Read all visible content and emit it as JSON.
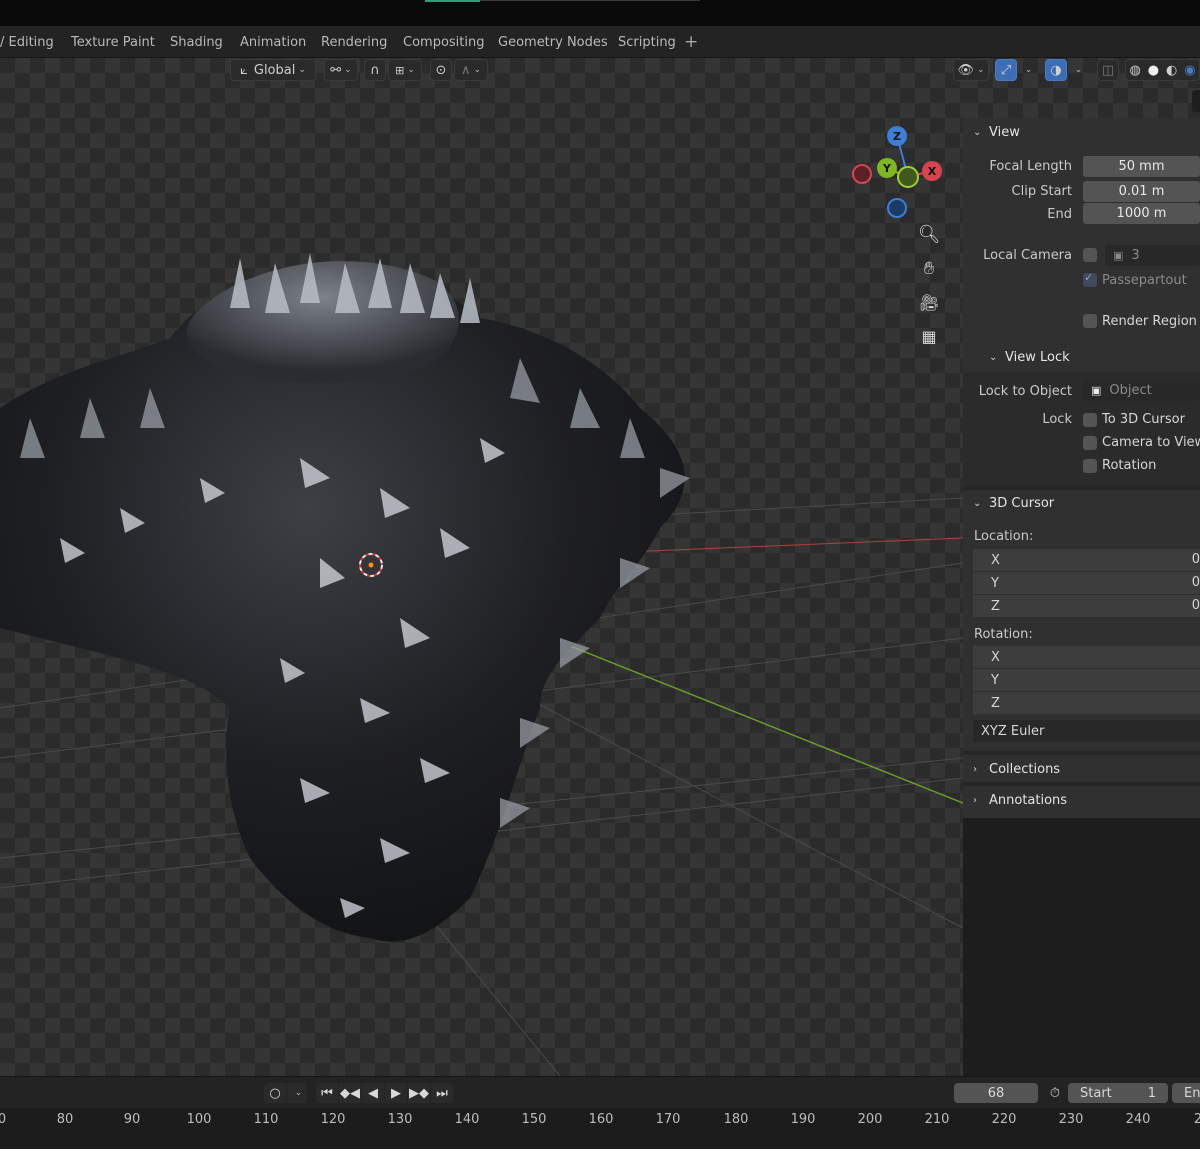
{
  "workspace_tabs": [
    "/ Editing",
    "Texture Paint",
    "Shading",
    "Animation",
    "Rendering",
    "Compositing",
    "Geometry Nodes",
    "Scripting"
  ],
  "add_tab_label": "+",
  "viewport_header": {
    "orientation_label": "Global"
  },
  "gizmo": {
    "x_label": "X",
    "y_label": "Y",
    "z_label": "Z"
  },
  "sidebar": {
    "view": {
      "title": "View",
      "focal_length_label": "Focal Length",
      "focal_length_value": "50 mm",
      "clip_start_label": "Clip Start",
      "clip_start_value": "0.01 m",
      "clip_end_label": "End",
      "clip_end_value": "1000 m",
      "local_camera_label": "Local Camera",
      "local_camera_value": "3",
      "passepartout_label": "Passepartout",
      "render_region_label": "Render Region"
    },
    "view_lock": {
      "title": "View Lock",
      "lock_to_object_label": "Lock to Object",
      "lock_to_object_placeholder": "Object",
      "lock_label": "Lock",
      "to_3d_cursor_label": "To 3D Cursor",
      "camera_to_view_label": "Camera to View",
      "rotation_label": "Rotation"
    },
    "cursor": {
      "title": "3D Cursor",
      "location_label": "Location:",
      "rotation_label": "Rotation:",
      "axes": [
        "X",
        "Y",
        "Z"
      ],
      "location_values_partial": [
        "0",
        "0",
        "0"
      ],
      "rotation_mode": "XYZ Euler"
    },
    "collections_title": "Collections",
    "annotations_title": "Annotations"
  },
  "timeline": {
    "current_frame": "68",
    "start_label": "Start",
    "start_value": "1",
    "end_label_partial": "En",
    "ruler_ticks": [
      "0",
      "80",
      "90",
      "100",
      "110",
      "120",
      "130",
      "140",
      "150",
      "160",
      "170",
      "180",
      "190",
      "200",
      "210",
      "220",
      "230",
      "240",
      "2"
    ]
  },
  "colors": {
    "accent_blue": "#3d6eb5",
    "axis_x": "#d9434f",
    "axis_y": "#7fb622",
    "axis_z": "#3b7fd6",
    "panel_bg": "#303030",
    "grid_x_line": "#b04040",
    "grid_y_line": "#6a9a2a"
  }
}
